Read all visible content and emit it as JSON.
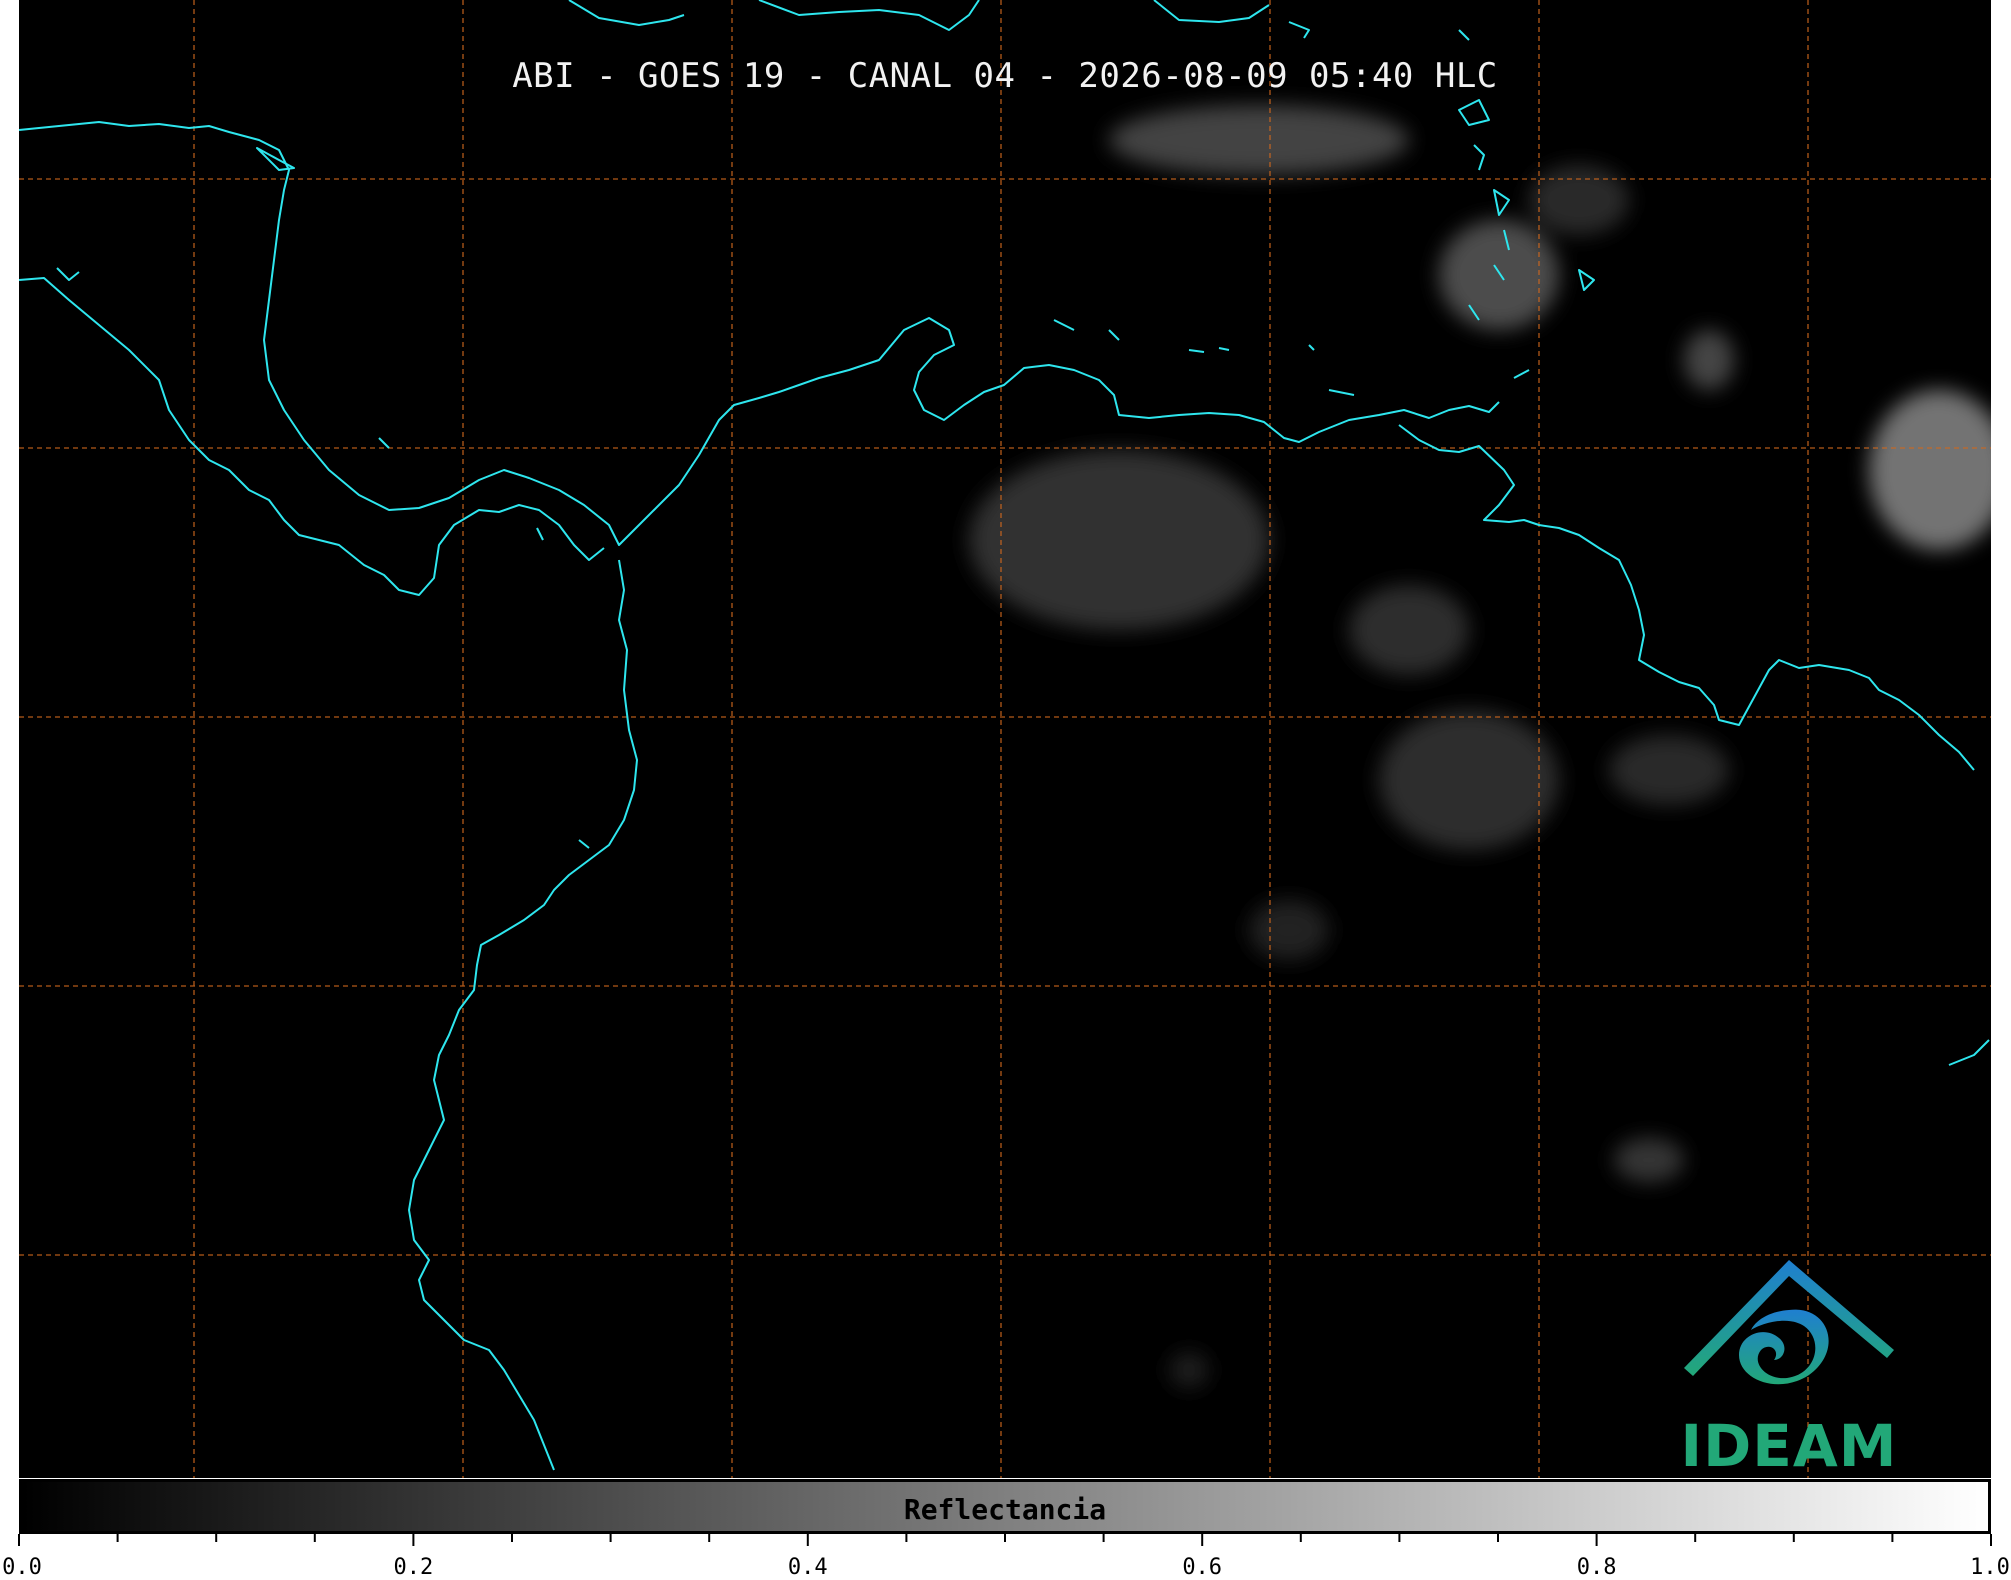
{
  "title": "ABI - GOES 19 - CANAL 04 - 2026-08-09 05:40 HLC",
  "logo": {
    "text": "IDEAM",
    "color": "#22a878",
    "accent": "#1f7fd0"
  },
  "colors": {
    "background": "#000000",
    "coastline": "#2ee6ee",
    "gridline": "#d2691e",
    "cloud": "#9a9a9a"
  },
  "colorbar": {
    "label": "Reflectancia",
    "min": 0.0,
    "max": 1.0,
    "tick_labels": [
      "0.0",
      "0.2",
      "0.4",
      "0.6",
      "0.8",
      "1.0"
    ],
    "minor_tick_step": 0.05
  }
}
